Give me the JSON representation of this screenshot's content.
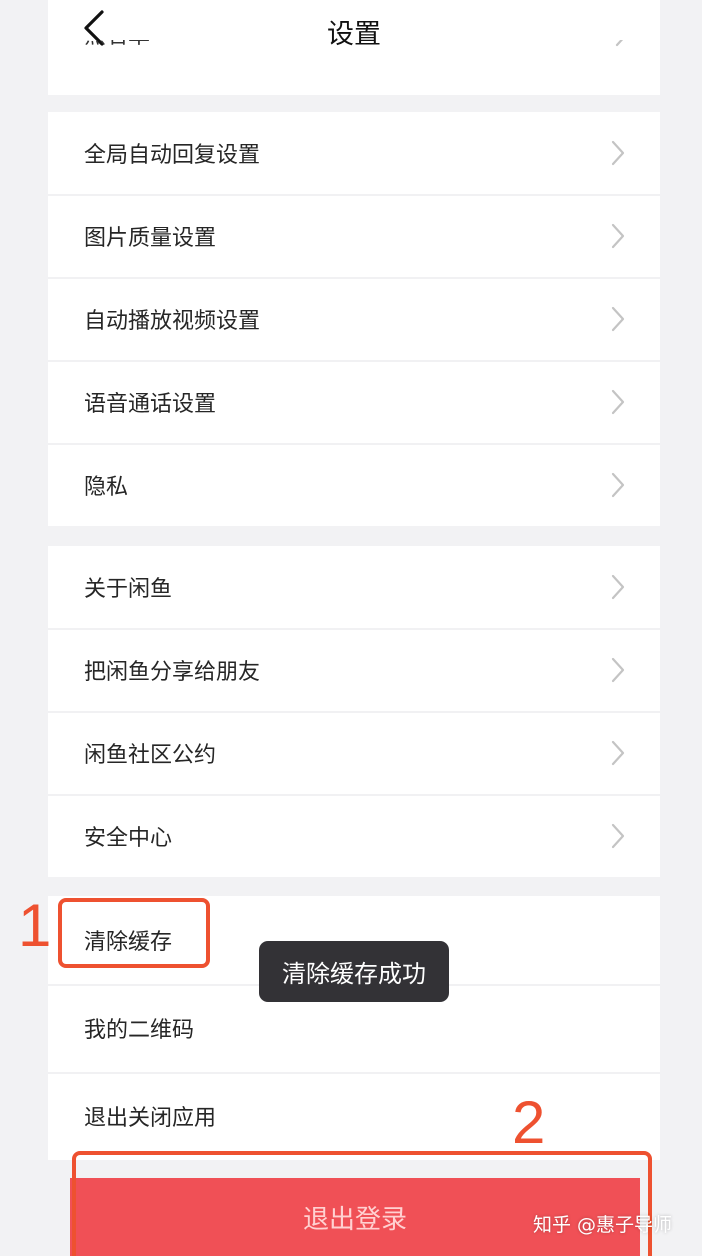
{
  "header": {
    "title": "设置",
    "clipped_item": "黑名单"
  },
  "group1": {
    "items": [
      {
        "label": "全局自动回复设置"
      },
      {
        "label": "图片质量设置"
      },
      {
        "label": "自动播放视频设置"
      },
      {
        "label": "语音通话设置"
      },
      {
        "label": "隐私"
      }
    ]
  },
  "group2": {
    "items": [
      {
        "label": "关于闲鱼"
      },
      {
        "label": "把闲鱼分享给朋友"
      },
      {
        "label": "闲鱼社区公约"
      },
      {
        "label": "安全中心"
      }
    ]
  },
  "group3": {
    "items": [
      {
        "label": "清除缓存"
      },
      {
        "label": "我的二维码"
      },
      {
        "label": "退出关闭应用"
      }
    ]
  },
  "toast": {
    "text": "清除缓存成功"
  },
  "logout": {
    "label": "退出登录"
  },
  "annotations": {
    "step1": "1",
    "step2": "2"
  },
  "watermark": {
    "text": "知乎 @惠子导师"
  },
  "colors": {
    "annotation": "#ee5130",
    "logout_bg": "#f05056",
    "toast_bg": "#333236",
    "page_bg": "#f2f2f4"
  },
  "icons": {
    "back": "chevron-left-icon",
    "row_arrow": "chevron-right-icon"
  }
}
